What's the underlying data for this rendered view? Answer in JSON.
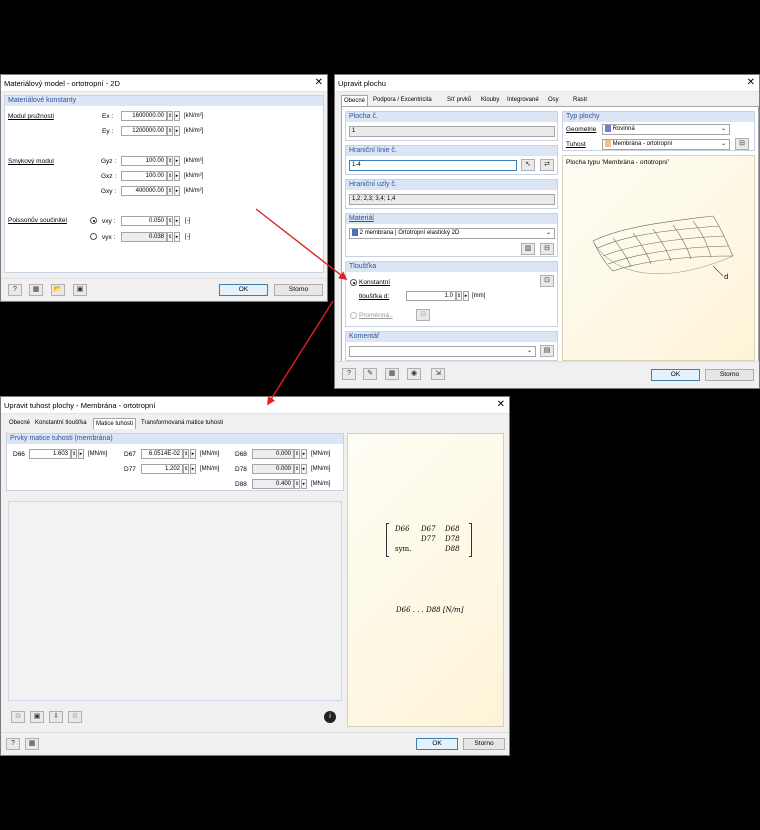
{
  "win1": {
    "title": "Materiálový model - ortotropní - 2D",
    "group_title": "Materiálové konstanty",
    "modulus_label": "Modul pružnosti",
    "ex_label": "Ex :",
    "ex_value": "1600000.00",
    "ex_unit": "[kN/m²]",
    "ey_label": "Ey :",
    "ey_value": "1200000.00",
    "ey_unit": "[kN/m²]",
    "shear_label": "Smykový modul",
    "gyz_label": "Gyz :",
    "gyz_value": "100.00",
    "gyz_unit": "[kN/m²]",
    "gxz_label": "Gxz :",
    "gxz_value": "100.00",
    "gxz_unit": "[kN/m²]",
    "gxy_label": "Gxy :",
    "gxy_value": "400000.00",
    "gxy_unit": "[kN/m²]",
    "poisson_label": "Poissonův součinitel",
    "vxy_label": "νxy :",
    "vxy_value": "0.050",
    "vxy_unit": "[-]",
    "vyx_label": "νyx :",
    "vyx_value": "0.038",
    "vyx_unit": "[-]",
    "ok": "OK",
    "cancel": "Storno"
  },
  "win2": {
    "title": "Upravit plochu",
    "tabs": [
      "Obecné",
      "Podpora / Excentricita",
      "Síť prvků",
      "Klouby",
      "Integrované",
      "Osy",
      "Rastr"
    ],
    "surface_no_h": "Plocha č.",
    "surface_no": "1",
    "boundary_h": "Hraniční linie č.",
    "boundary": "1-4",
    "nodes_h": "Hraniční uzly č.",
    "nodes": "1,2; 2,3; 3,4; 1,4",
    "material_h": "Materiál",
    "material_no": "2",
    "material_name": "membrana",
    "material_model": "Ortotropní elastický 2D",
    "thickness_h": "Tloušťka",
    "constant": "Konstantní",
    "thickness_label": "tloušťka d:",
    "thickness_value": "1.0",
    "thickness_unit": "[mm]",
    "variable": "Proměnná..",
    "comment_h": "Komentář",
    "type_h": "Typ plochy",
    "geometry_label": "Geometrie",
    "geometry_value": "Rovinná",
    "stiffness_label": "Tuhost",
    "stiffness_value": "Membrána - ortotropní",
    "preview_caption": "Plocha typu 'Membrána - ortotropní'",
    "d_label": "d",
    "ok": "OK",
    "cancel": "Storno"
  },
  "win3": {
    "title": "Upravit tuhost plochy - Membrána - ortotropní",
    "tabs": [
      "Obecné",
      "Konstantní tloušťka",
      "Matice tuhosti",
      "Transformovaná matice tuhosti"
    ],
    "group_title": "Prvky matice tuhosti (membrána)",
    "d66_label": "D66",
    "d66_value": "1.603",
    "d66_unit": "[MN/m]",
    "d67_label": "D67",
    "d67_value": "6.0514E-02",
    "d67_unit": "[MN/m]",
    "d68_label": "D68",
    "d68_value": "0.000",
    "d68_unit": "[MN/m]",
    "d77_label": "D77",
    "d77_value": "1.202",
    "d77_unit": "[MN/m]",
    "d78_label": "D78",
    "d78_value": "0.000",
    "d78_unit": "[MN/m]",
    "d88_label": "D88",
    "d88_value": "0.400",
    "d88_unit": "[MN/m]",
    "m_d66": "D66",
    "m_d67": "D67",
    "m_d68": "D68",
    "m_d77": "D77",
    "m_d78": "D78",
    "m_sym": "sym.",
    "m_d88": "D88",
    "m_units": "D66 . . . D88   [N/m]",
    "ok": "OK",
    "cancel": "Storno"
  },
  "colors": {
    "arrow": "#e02020",
    "group_header": "#dbe5f3",
    "group_text": "#2a55a4"
  }
}
